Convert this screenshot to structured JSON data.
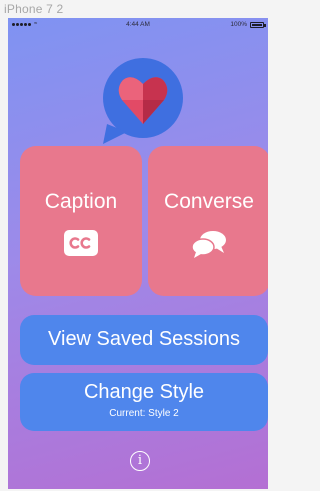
{
  "device": {
    "label": "iPhone 7 2"
  },
  "statusbar": {
    "time": "4:44 AM",
    "battery": "100%",
    "wifi_icon": "wifi-icon"
  },
  "logo": {
    "icon": "speech-bubble-heart-icon",
    "bubble_color": "#3f6fe0",
    "heart_color": "#e24a66"
  },
  "tiles": [
    {
      "label": "Caption",
      "icon": "closed-caption-icon"
    },
    {
      "label": "Converse",
      "icon": "chat-bubbles-icon"
    }
  ],
  "saved_sessions": {
    "label": "View Saved Sessions"
  },
  "change_style": {
    "label": "Change Style",
    "current": "Current: Style 2"
  },
  "info": {
    "glyph": "i"
  },
  "colors": {
    "tile": "#e8788d",
    "button": "#4f86ec",
    "bg_top": "#7f93f2",
    "bg_bottom": "#b46fd3"
  }
}
